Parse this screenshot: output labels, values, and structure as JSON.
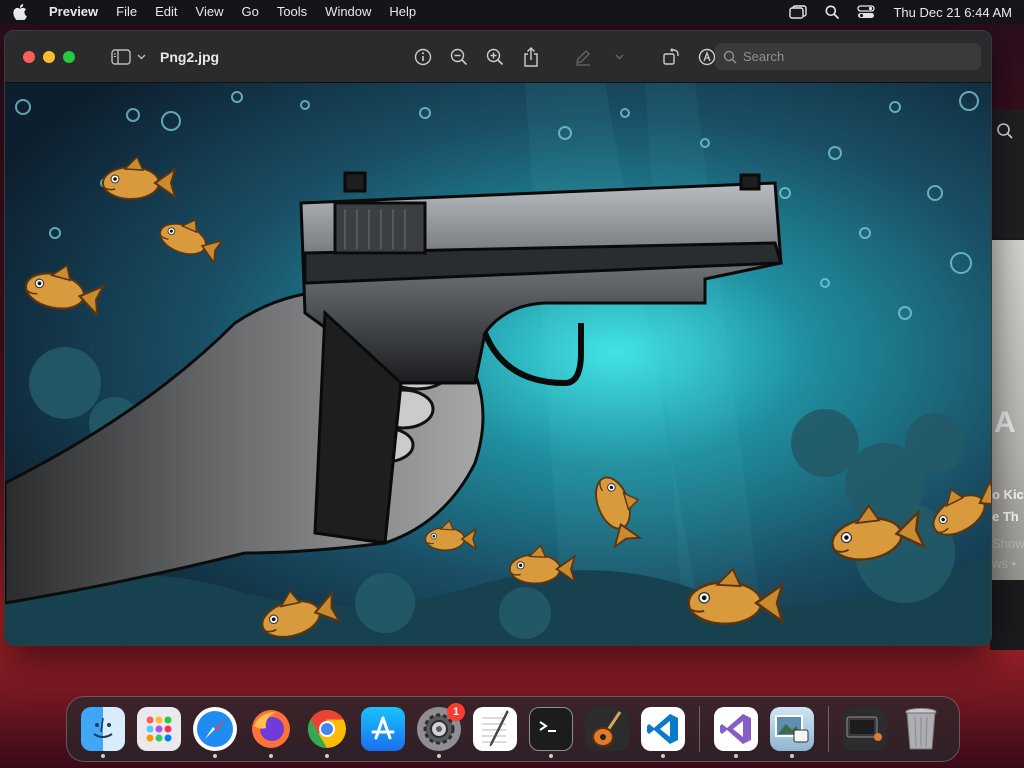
{
  "menubar": {
    "app_name": "Preview",
    "items": [
      "File",
      "Edit",
      "View",
      "Go",
      "Tools",
      "Window",
      "Help"
    ],
    "clock": "Thu Dec 21  6:44 AM"
  },
  "window": {
    "title": "Png2.jpg",
    "search_placeholder": "Search"
  },
  "background_app": {
    "big_text": "A",
    "headline_line1": "o Kic",
    "headline_line2": "e Th",
    "meta_line1": "Show",
    "meta_line2": "ws • "
  },
  "dock": {
    "apps": [
      "Finder",
      "Launchpad",
      "Safari",
      "Firefox",
      "Chrome",
      "App Store",
      "System Settings",
      "TextEdit",
      "Terminal",
      "GarageBand",
      "Visual Studio Code",
      "Visual Studio",
      "Preview",
      "Screen Capture",
      "Trash"
    ],
    "system_settings_badge": "1"
  },
  "colors": {
    "close": "#ff5f57",
    "minimize": "#febc2e",
    "maximize": "#28c840",
    "badge": "#ff3b30"
  }
}
